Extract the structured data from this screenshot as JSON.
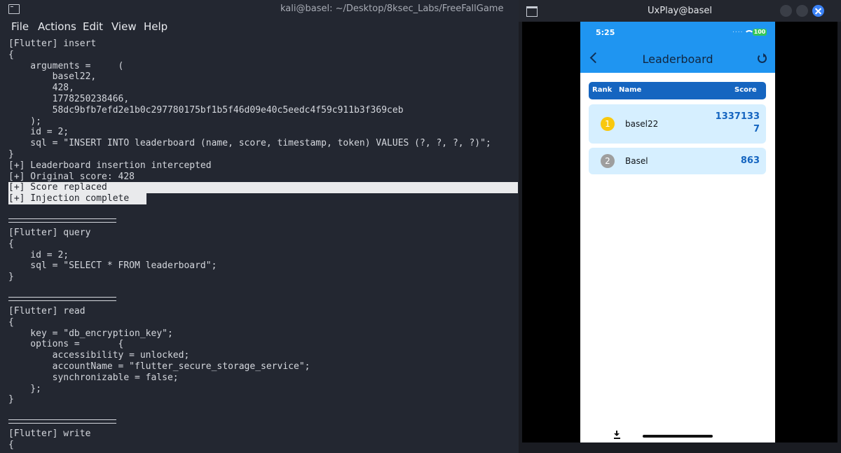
{
  "terminal": {
    "title": "kali@basel: ~/Desktop/8ksec_Labs/FreeFallGame",
    "menu": [
      "File",
      "Actions",
      "Edit",
      "View",
      "Help"
    ],
    "lines": [
      "[Flutter] insert",
      "{",
      "    arguments =     (",
      "        basel22,",
      "        428,",
      "        1778250238466,",
      "        58dc9bfb7efd2e1b0c297780175bf1b5f46d09e40c5eedc4f59c911b3f369ceb",
      "    );",
      "    id = 2;",
      "    sql = \"INSERT INTO leaderboard (name, score, timestamp, token) VALUES (?, ?, ?, ?)\";",
      "}",
      "[+] Leaderboard insertion intercepted",
      "[+] Original score: 428",
      "[+] Score replaced",
      "[+] Injection complete",
      "[Flutter] query",
      "{",
      "    id = 2;",
      "    sql = \"SELECT * FROM leaderboard\";",
      "}",
      "[Flutter] read",
      "{",
      "    key = \"db_encryption_key\";",
      "    options =       {",
      "        accessibility = unlocked;",
      "        accountName = \"flutter_secure_storage_service\";",
      "        synchronizable = false;",
      "    };",
      "}",
      "[Flutter] write",
      "{"
    ]
  },
  "uxplay": {
    "title": "UxPlay@basel",
    "phone": {
      "time": "5:25",
      "signal_dots": "....",
      "battery": "100",
      "screen_title": "Leaderboard",
      "columns": {
        "rank": "Rank",
        "name": "Name",
        "score": "Score"
      },
      "rows": [
        {
          "rank": "1",
          "name": "basel22",
          "score": "13371337",
          "badge_color": "#f9c80e"
        },
        {
          "rank": "2",
          "name": "Basel",
          "score": "863",
          "badge_color": "#9e9e9e"
        }
      ]
    }
  }
}
